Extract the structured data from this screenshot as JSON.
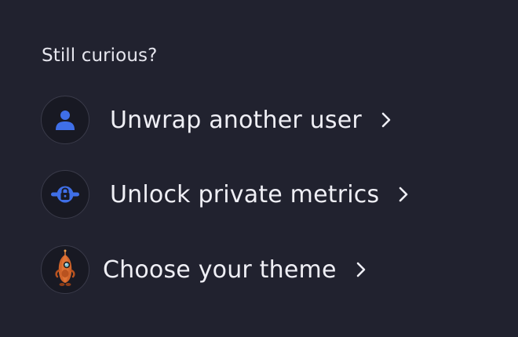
{
  "heading": "Still curious?",
  "items": [
    {
      "label": "Unwrap another user",
      "icon": "user-icon"
    },
    {
      "label": "Unlock private metrics",
      "icon": "lock-icon"
    },
    {
      "label": "Choose your theme",
      "icon": "rocket-mascot-icon"
    }
  ],
  "colors": {
    "background": "#21222f",
    "icon_circle": "#181923",
    "accent_blue": "#3f6fe8",
    "text": "#efeff5"
  }
}
